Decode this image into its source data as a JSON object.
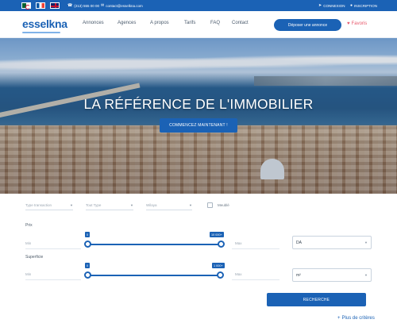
{
  "topbar": {
    "flags": [
      "algeria-flag",
      "france-flag",
      "uk-flag"
    ],
    "phone": "(213) 555 00 00",
    "email": "contact@esselkna.com",
    "login": "CONNEXION",
    "signup": "INSCRIPTION"
  },
  "nav": {
    "logo": "esselkna",
    "menu": [
      "Annonces",
      "Agences",
      "A propos",
      "Tarifs",
      "FAQ",
      "Contact"
    ],
    "cta": "Déposer une annonce",
    "favorites": "Favoris",
    "accent": "#1b62b5"
  },
  "hero": {
    "title": "LA RÉFÉRENCE DE L'IMMOBILIER",
    "button": "COMMENCEZ MAINTENANT !"
  },
  "form": {
    "transaction_placeholder": "Type transaction",
    "type_placeholder": "Tout Type",
    "wilaya_placeholder": "Wilaya",
    "checkbox_label": "Meublé",
    "prix": {
      "label": "Prix",
      "min_label": "Min",
      "max_label": "Max",
      "min_value": "0",
      "max_value": "10 000+",
      "currency": "DA"
    },
    "superficie": {
      "label": "Superficie",
      "min_label": "Min",
      "max_label": "Max",
      "min_value": "0",
      "max_value": "1 000+",
      "unit": "m²"
    },
    "search_button": "RECHERCHE",
    "more_criteria": "Plus de critères"
  }
}
